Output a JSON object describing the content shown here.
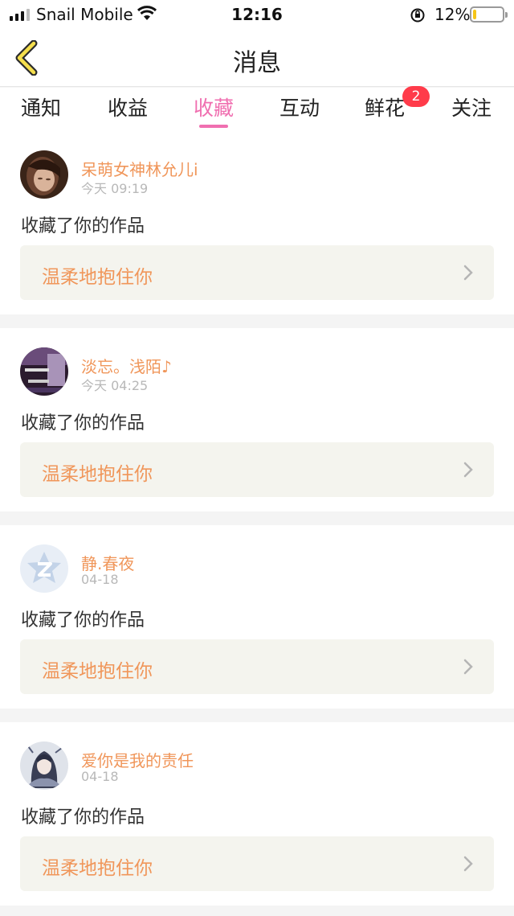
{
  "status_bar": {
    "carrier": "Snail Mobile",
    "time": "12:16",
    "battery_percent": "12%",
    "battery_level": 0.12,
    "icons": [
      "signal-icon",
      "wifi-icon",
      "rotation-lock-icon",
      "battery-icon"
    ]
  },
  "header": {
    "title": "消息",
    "back_icon": "chevron-left-icon"
  },
  "tabs": [
    {
      "label": "通知"
    },
    {
      "label": "收益"
    },
    {
      "label": "收藏",
      "active": true
    },
    {
      "label": "互动"
    },
    {
      "label": "鲜花",
      "badge": "2"
    },
    {
      "label": "关注"
    }
  ],
  "colors": {
    "accent_pink": "#f06fb0",
    "name_orange": "#f0965a",
    "badge_red": "#ff3b4a",
    "battery_yellow": "#f5c518"
  },
  "items": [
    {
      "user": "呆萌女神林允儿i",
      "time": "今天 09:19",
      "action": "收藏了你的作品",
      "work": "温柔地抱住你",
      "avatar": "photo-avatar"
    },
    {
      "user": "淡忘。浅陌♪",
      "time": "今天 04:25",
      "action": "收藏了你的作品",
      "work": "温柔地抱住你",
      "avatar": "graphic-avatar"
    },
    {
      "user": "静.春夜",
      "time": "04-18",
      "action": "收藏了你的作品",
      "work": "温柔地抱住你",
      "avatar": "default-avatar"
    },
    {
      "user": "爱你是我的责任",
      "time": "04-18",
      "action": "收藏了你的作品",
      "work": "温柔地抱住你",
      "avatar": "anime-avatar"
    }
  ]
}
